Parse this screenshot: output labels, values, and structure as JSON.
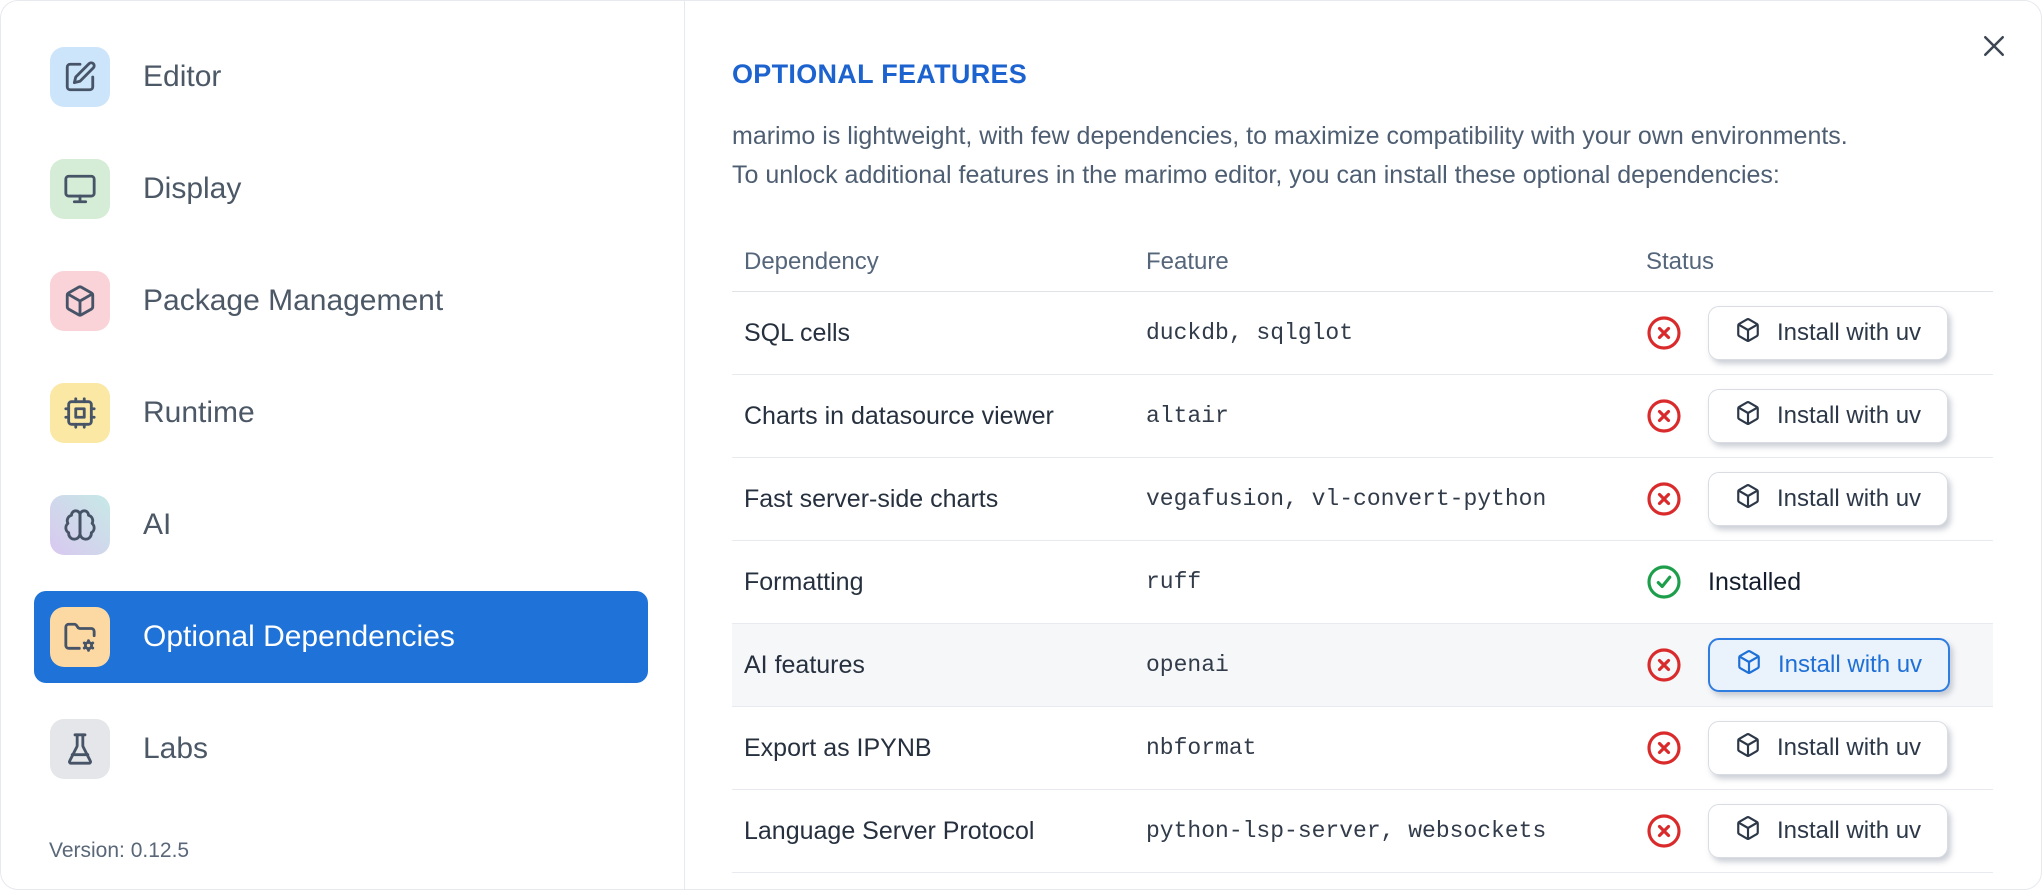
{
  "sidebar": {
    "items": [
      {
        "label": "Editor",
        "icon": "square-pen",
        "tile": "#cde5fa"
      },
      {
        "label": "Display",
        "icon": "monitor",
        "tile": "#d5ecd6"
      },
      {
        "label": "Package Management",
        "icon": "box",
        "tile": "#f9d3d8"
      },
      {
        "label": "Runtime",
        "icon": "cpu",
        "tile": "#fbe8a4"
      },
      {
        "label": "AI",
        "icon": "brain",
        "tile_gradient": [
          "#c6e9e6",
          "#d9c8f0"
        ]
      },
      {
        "label": "Optional Dependencies",
        "icon": "folder-cog",
        "tile": "#fcd9a2",
        "selected": true
      },
      {
        "label": "Labs",
        "icon": "flask",
        "tile": "#e5e6e9"
      }
    ],
    "version": "Version: 0.12.5"
  },
  "main": {
    "title": "OPTIONAL FEATURES",
    "description_line1": "marimo is lightweight, with few dependencies, to maximize compatibility with your own environments.",
    "description_line2": "To unlock additional features in the marimo editor, you can install these optional dependencies:",
    "table": {
      "headers": [
        "Dependency",
        "Feature",
        "Status"
      ],
      "install_button_label": "Install with uv",
      "installed_label": "Installed",
      "rows": [
        {
          "dependency": "SQL cells",
          "feature": "duckdb, sqlglot",
          "installed": false
        },
        {
          "dependency": "Charts in datasource viewer",
          "feature": "altair",
          "installed": false
        },
        {
          "dependency": "Fast server-side charts",
          "feature": "vegafusion, vl-convert-python",
          "installed": false
        },
        {
          "dependency": "Formatting",
          "feature": "ruff",
          "installed": true
        },
        {
          "dependency": "AI features",
          "feature": "openai",
          "installed": false,
          "focused": true
        },
        {
          "dependency": "Export as IPYNB",
          "feature": "nbformat",
          "installed": false
        },
        {
          "dependency": "Language Server Protocol",
          "feature": "python-lsp-server, websockets",
          "installed": false
        }
      ]
    }
  },
  "colors": {
    "accent_selected": "#1f72d8",
    "title_blue": "#1c63cf",
    "status_error_red": "#d92b2b",
    "status_ok_green": "#1d9e4b",
    "focus_button_blue": "#2f7de0"
  }
}
